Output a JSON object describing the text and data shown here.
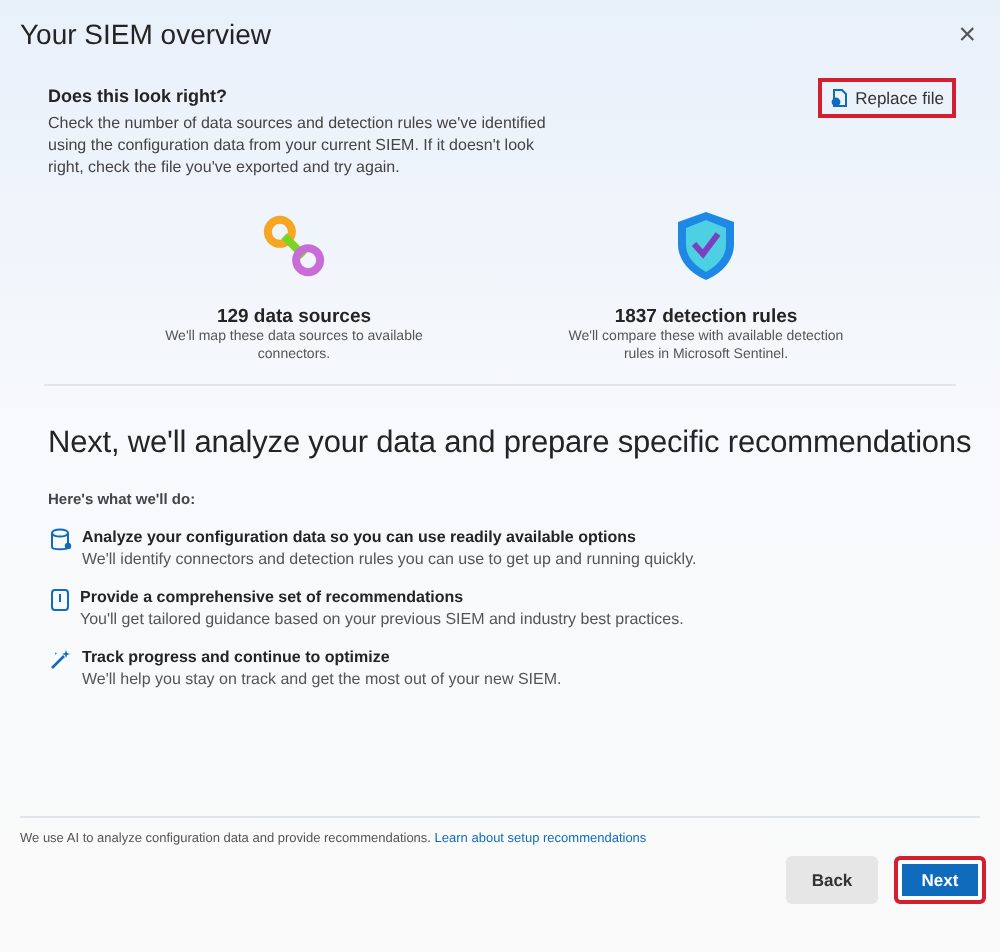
{
  "window": {
    "title": "Your SIEM overview",
    "close": "×"
  },
  "review": {
    "title": "Does this look right?",
    "text": "Check the number of data sources and detection rules we've identified using the configuration data from your current SIEM. If it doesn't look right, check the file you've exported and try again.",
    "button": {
      "label": "Replace file",
      "highlighted": true
    }
  },
  "stats": [
    {
      "kind": "link",
      "value": "129 data sources",
      "text": "We'll map these data sources to available connectors."
    },
    {
      "kind": "shield",
      "value": "1837 detection rules",
      "text": "We'll compare these with available detection rules in Microsoft Sentinel."
    }
  ],
  "next": {
    "heading": "Next, we'll analyze your data and prepare specific recommendations",
    "intro": "Here's what we'll do:",
    "steps": [
      {
        "kind": "analyze",
        "title": "Analyze your configuration data so you can use readily available options",
        "text": "We'll identify connectors and detection rules you can use to get up and running quickly."
      },
      {
        "kind": "recommend",
        "title": "Provide a comprehensive set of recommendations",
        "text": "You'll get tailored guidance based on your previous SIEM and industry best practices."
      },
      {
        "kind": "optimize",
        "title": "Track progress and continue to optimize",
        "text": "We'll help you stay on track and get the most out of your new SIEM."
      }
    ]
  },
  "footer": {
    "note": "We use AI to analyze configuration data and provide recommendations.",
    "link": "Learn about setup recommendations"
  },
  "buttons": [
    {
      "kind": "secondary",
      "label": "Back",
      "highlighted": false
    },
    {
      "kind": "primary",
      "label": "Next",
      "highlighted": true
    }
  ]
}
